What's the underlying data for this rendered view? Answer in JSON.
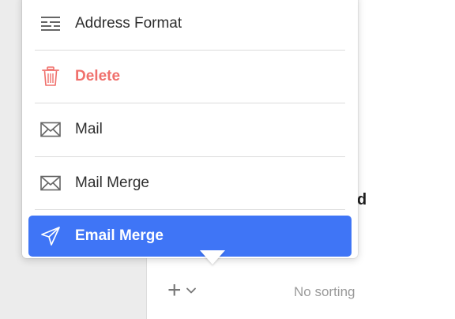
{
  "menu": {
    "items": [
      {
        "label": "Address Format",
        "icon": "address-format-icon"
      },
      {
        "label": "Delete",
        "icon": "trash-icon",
        "color": "#f0706c"
      },
      {
        "label": "Mail",
        "icon": "envelope-icon"
      },
      {
        "label": "Mail Merge",
        "icon": "envelope-icon"
      },
      {
        "label": "Email Merge",
        "icon": "paper-plane-icon",
        "selected": true,
        "highlight_color": "#3f75f6"
      }
    ]
  },
  "main": {
    "text_fragment": "d"
  },
  "bottom_bar": {
    "add_icon": "plus-icon",
    "dropdown_icon": "chevron-down-icon",
    "sorting_label": "No sorting"
  }
}
